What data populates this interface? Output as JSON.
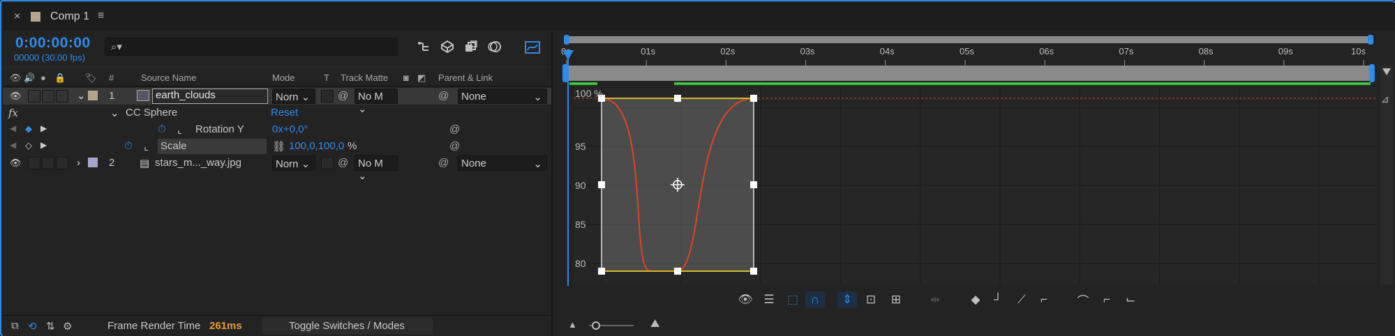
{
  "tab": {
    "close": "×",
    "title": "Comp 1",
    "menu": "≡",
    "swatch_color": "#b6a58a"
  },
  "timecode": {
    "current": "0:00:00:00",
    "fps": "00000 (30.00 fps)"
  },
  "search": {
    "placeholder": ""
  },
  "columns": {
    "label": "#",
    "source_name": "Source Name",
    "mode": "Mode",
    "t": "T",
    "track_matte": "Track Matte",
    "parent_link": "Parent & Link"
  },
  "layers": [
    {
      "index": "1",
      "name": "earth_clouds",
      "mode": "Norn",
      "matte": "No M",
      "parent": "None",
      "swatch": "#b6a58a"
    },
    {
      "index": "2",
      "name": "stars_m..._way.jpg",
      "mode": "Norn",
      "matte": "No M",
      "parent": "None",
      "swatch": "#a8a6c8"
    }
  ],
  "effect": {
    "fx": "fx",
    "name": "CC Sphere",
    "reset": "Reset"
  },
  "props": [
    {
      "name": "Rotation Y",
      "value": "0x+0,0°"
    },
    {
      "name": "Scale",
      "value": "100,0,100,0",
      "unit": "%"
    }
  ],
  "footer": {
    "frame_render_label": "Frame Render Time",
    "frame_render_value": "261ms",
    "toggle": "Toggle Switches / Modes"
  },
  "ruler": {
    "ticks": [
      "0s",
      "01s",
      "02s",
      "03s",
      "04s",
      "05s",
      "06s",
      "07s",
      "08s",
      "09s",
      "10s"
    ]
  },
  "graph": {
    "y_labels": [
      "100 %",
      "95",
      "90",
      "85",
      "80"
    ],
    "accent": "#2d8ceb",
    "curve_color": "#e0451f",
    "handle_color": "#e0c020"
  }
}
